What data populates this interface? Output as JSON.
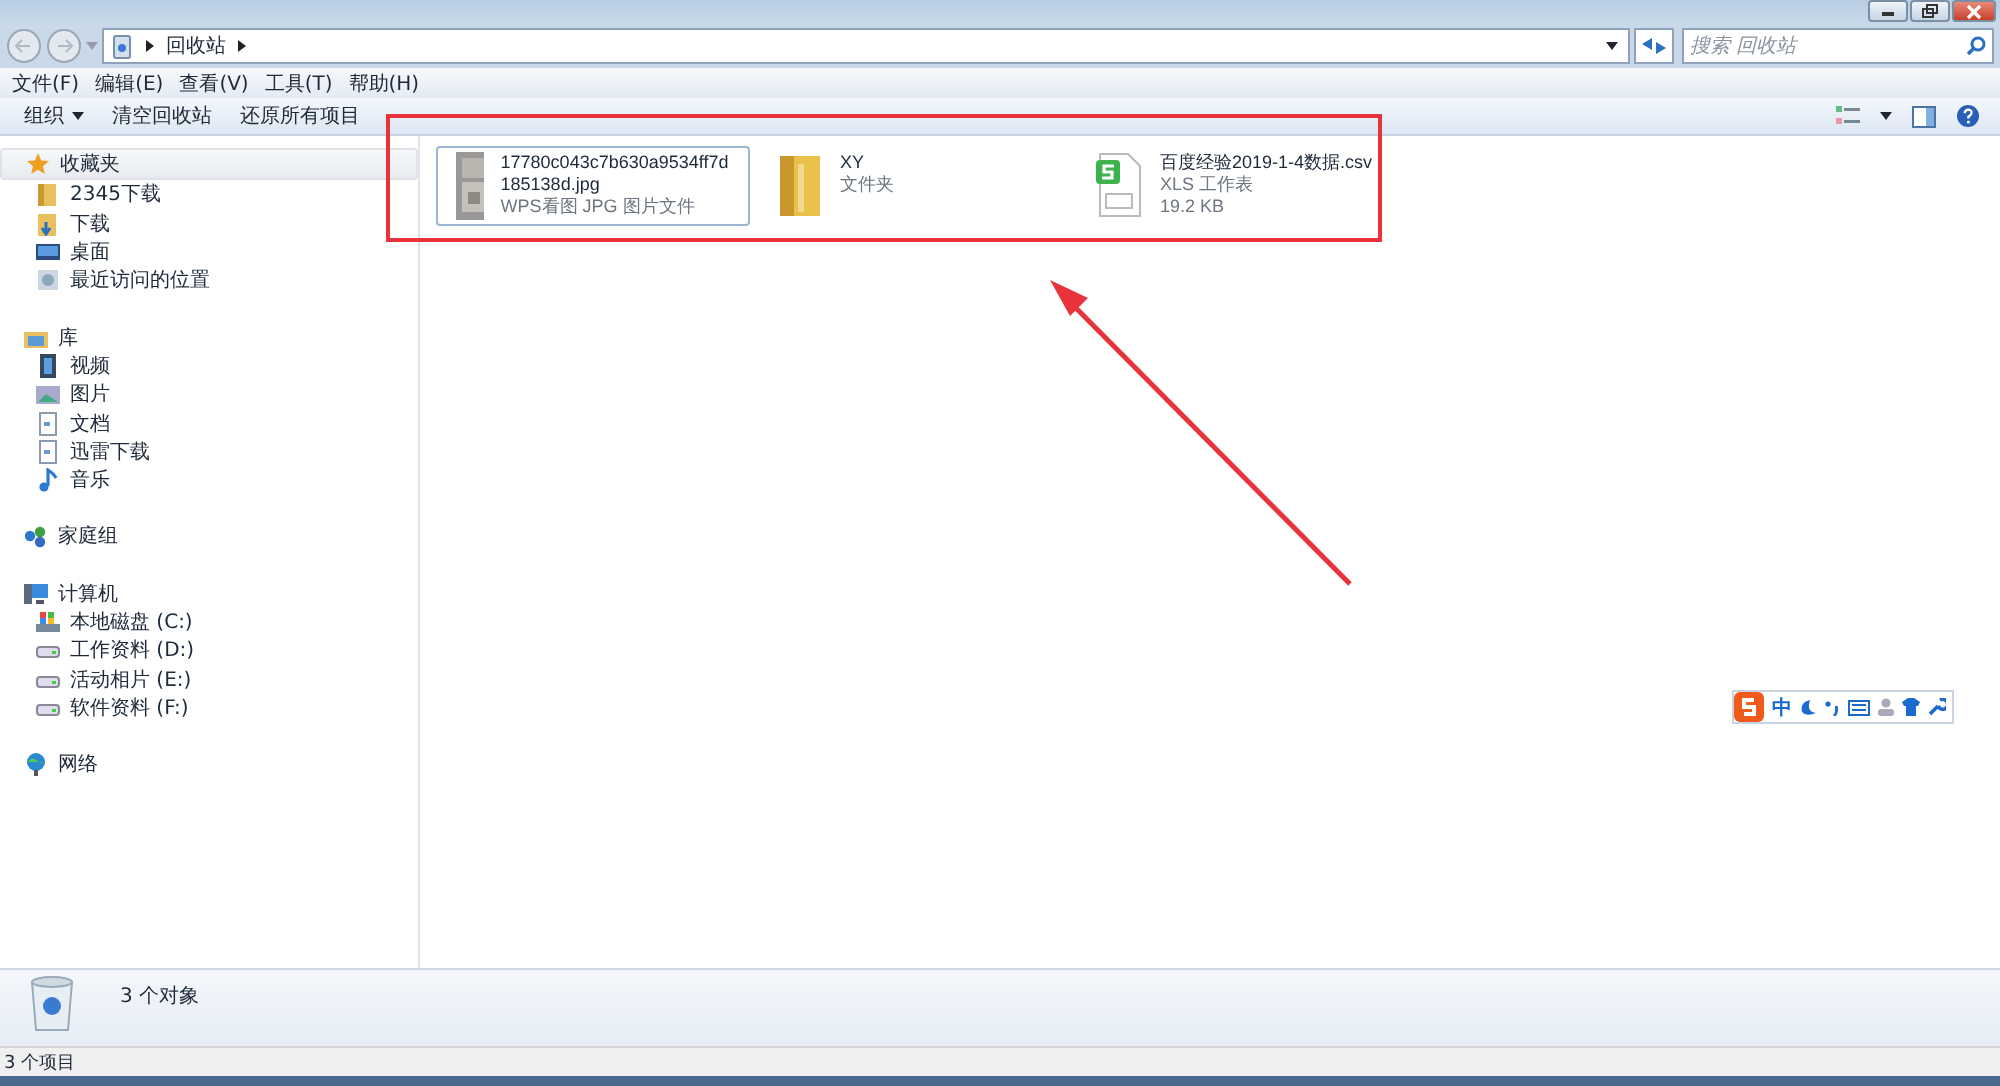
{
  "address": {
    "crumbs": [
      "回收站"
    ]
  },
  "search": {
    "placeholder": "搜索 回收站"
  },
  "menu": [
    "文件(F)",
    "编辑(E)",
    "查看(V)",
    "工具(T)",
    "帮助(H)"
  ],
  "toolbar": {
    "organize": "组织",
    "actions": [
      "清空回收站",
      "还原所有项目"
    ]
  },
  "sidebar": [
    {
      "label": "收藏夹",
      "kind": "star",
      "selected": true,
      "children": [
        {
          "label": "2345下载",
          "kind": "folder"
        },
        {
          "label": "下载",
          "kind": "download"
        },
        {
          "label": "桌面",
          "kind": "desktop"
        },
        {
          "label": "最近访问的位置",
          "kind": "recent"
        }
      ]
    },
    {
      "label": "库",
      "kind": "library",
      "selected": false,
      "children": [
        {
          "label": "视频",
          "kind": "video"
        },
        {
          "label": "图片",
          "kind": "picture"
        },
        {
          "label": "文档",
          "kind": "document"
        },
        {
          "label": "迅雷下载",
          "kind": "document"
        },
        {
          "label": "音乐",
          "kind": "music"
        }
      ]
    },
    {
      "label": "家庭组",
      "kind": "homegroup",
      "selected": false
    },
    {
      "label": "计算机",
      "kind": "computer",
      "selected": false,
      "children": [
        {
          "label": "本地磁盘 (C:)",
          "kind": "system-drive"
        },
        {
          "label": "工作资料 (D:)",
          "kind": "drive"
        },
        {
          "label": "活动相片 (E:)",
          "kind": "drive"
        },
        {
          "label": "软件资料 (F:)",
          "kind": "drive"
        }
      ]
    },
    {
      "label": "网络",
      "kind": "network",
      "selected": false
    }
  ],
  "files": [
    {
      "selected": true,
      "name": "17780c043c7b630a9534ff7d185138d.jpg",
      "lines": [
        "WPS看图 JPG 图片文件"
      ]
    },
    {
      "kind": "folder",
      "selected": false,
      "name": "XY",
      "lines": [
        "文件夹"
      ]
    },
    {
      "kind": "spreadsheet",
      "selected": false,
      "name": "百度经验2019-1-4数据.csv",
      "lines": [
        "XLS 工作表",
        "19.2 KB"
      ]
    }
  ],
  "ime": {
    "label": "中"
  },
  "details": {
    "text": "3 个对象"
  },
  "status_bar": {
    "text": "3 个项目"
  }
}
